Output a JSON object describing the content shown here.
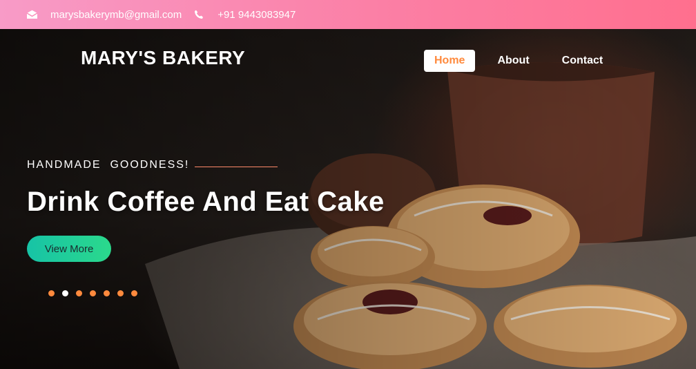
{
  "topbar": {
    "email": "marysbakerymb@gmail.com",
    "phone": "+91 9443083947",
    "email_icon": "envelope-icon",
    "phone_icon": "phone-icon"
  },
  "header": {
    "brand": "MARY'S BAKERY",
    "nav": [
      {
        "label": "Home",
        "active": true
      },
      {
        "label": "About",
        "active": false
      },
      {
        "label": "Contact",
        "active": false
      }
    ]
  },
  "hero": {
    "eyebrow": "HANDMADE  GOODNESS!",
    "headline": "Drink Coffee And Eat Cake",
    "cta_label": "View More",
    "slides": 7,
    "active_slide": 2
  },
  "colors": {
    "topbar_start": "#f89bc7",
    "topbar_end": "#ff6f8e",
    "accent_orange": "#ff8a3d",
    "cta_start": "#17c3a6",
    "cta_end": "#2bd98c"
  }
}
